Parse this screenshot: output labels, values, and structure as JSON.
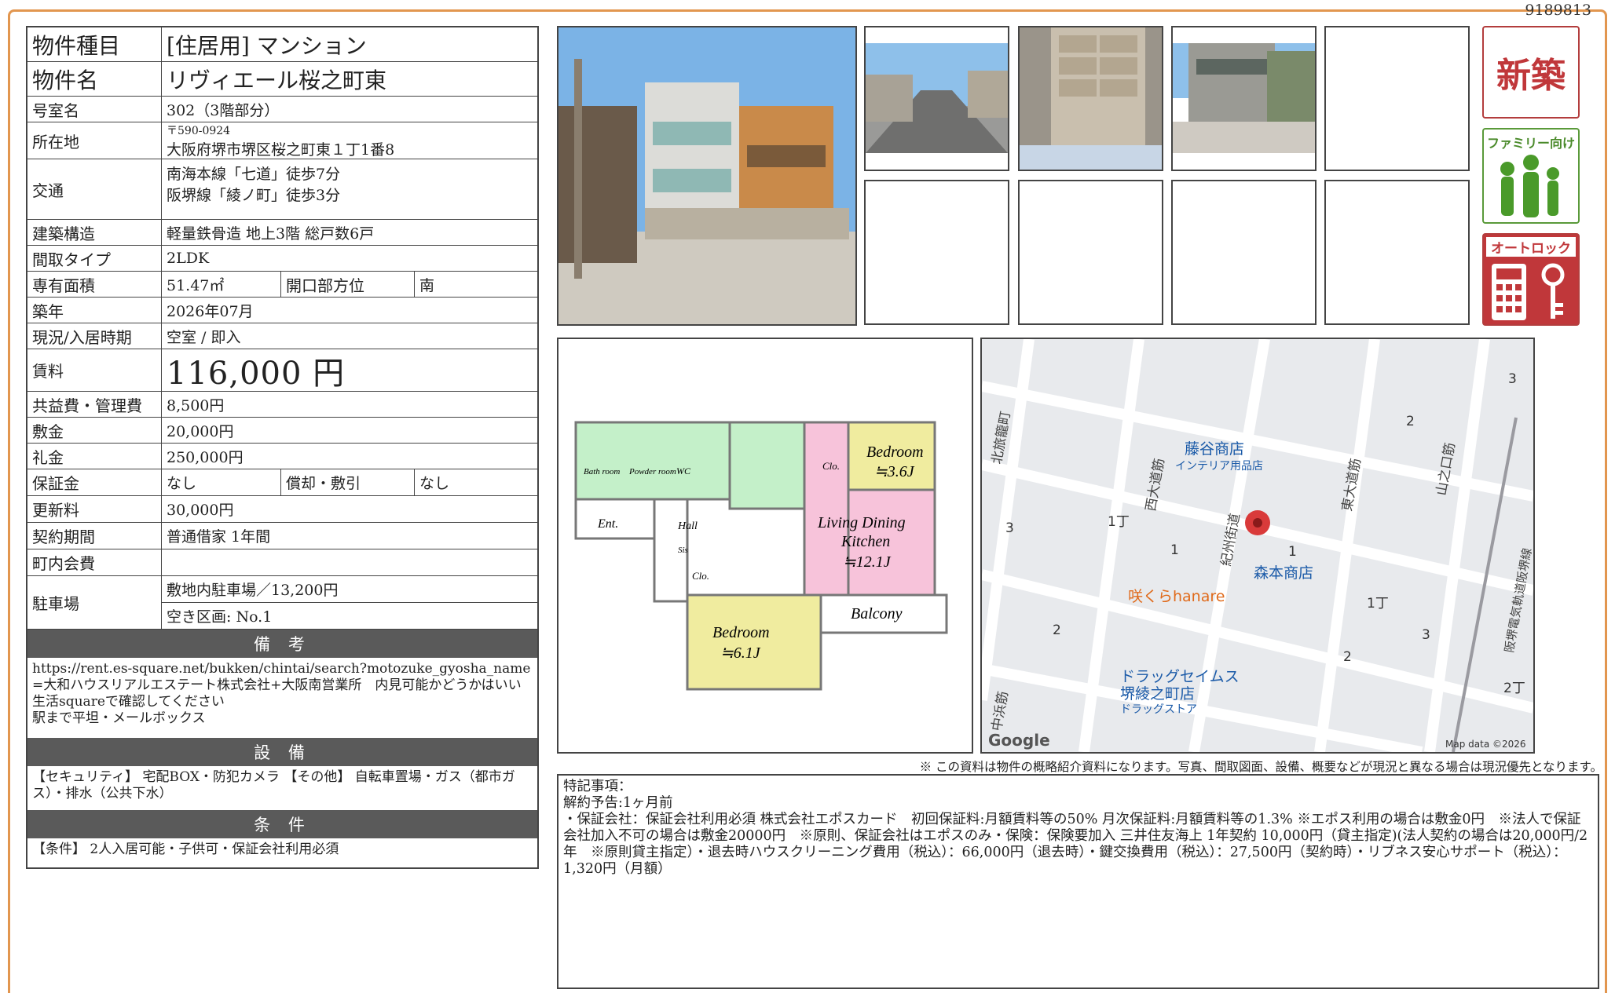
{
  "doc_id": "9189813",
  "table": {
    "type": {
      "label": "物件種目",
      "value": "[住居用]  マンション"
    },
    "name": {
      "label": "物件名",
      "value": "リヴィエール桜之町東"
    },
    "room": {
      "label": "号室名",
      "value": "302（3階部分）"
    },
    "address": {
      "label": "所在地",
      "zip": "〒590-0924",
      "value": "大阪府堺市堺区桜之町東１丁1番8"
    },
    "transport": {
      "label": "交通",
      "line1": "南海本線「七道」徒歩7分",
      "line2": "阪堺線「綾ノ町」徒歩3分"
    },
    "structure": {
      "label": "建築構造",
      "value": "軽量鉄骨造  地上3階  総戸数6戸"
    },
    "layout": {
      "label": "間取タイプ",
      "value": "2LDK"
    },
    "area": {
      "label": "専有面積",
      "value": "51.47㎡",
      "label2": "開口部方位",
      "value2": "南"
    },
    "built": {
      "label": "築年",
      "value": "2026年07月"
    },
    "status": {
      "label": "現況/入居時期",
      "value": "空室 / 即入"
    },
    "rent": {
      "label": "賃料",
      "value": "116,000 円"
    },
    "fee": {
      "label": "共益費・管理費",
      "value": "8,500円"
    },
    "deposit": {
      "label": "敷金",
      "value": "20,000円"
    },
    "key_money": {
      "label": "礼金",
      "value": "250,000円"
    },
    "guarantee": {
      "label": "保証金",
      "value": "なし",
      "label2": "償却・敷引",
      "value2": "なし"
    },
    "renewal": {
      "label": "更新料",
      "value": "30,000円"
    },
    "contract": {
      "label": "契約期間",
      "value": "普通借家 1年間"
    },
    "town_fee": {
      "label": "町内会費",
      "value": ""
    },
    "parking": {
      "label": "駐車場",
      "value1": "敷地内駐車場／13,200円",
      "value2": "空き区画: No.1"
    }
  },
  "remarks": {
    "title": "備 考",
    "text1": "https://rent.es-square.net/bukken/chintai/search?motozuke_gyosha_name=大和ハウスリアルエステート株式会社+大阪南営業所　内見可能かどうかはいい生活squareで確認してください",
    "text2": "駅まで平坦・メールボックス"
  },
  "equipment": {
    "title": "設 備",
    "text": "【セキュリティ】 宅配BOX・防犯カメラ 【その他】 自転車置場・ガス（都市ガス）・排水（公共下水）"
  },
  "conditions": {
    "title": "条 件",
    "text": "【条件】 2人入居可能・子供可・保証会社利用必須"
  },
  "badges": {
    "new": "新築",
    "family": "ファミリー向け",
    "autolock": "オートロック"
  },
  "floorplan": {
    "bedroom1": "Bedroom",
    "bedroom1_size": "≒3.6J",
    "ldk1": "Living Dining",
    "ldk2": "Kitchen",
    "ldk_size": "≒12.1J",
    "bedroom2": "Bedroom",
    "bedroom2_size": "≒6.1J",
    "balcony": "Balcony",
    "bath": "Bath room",
    "powder": "Powder room",
    "wc": "WC",
    "ent": "Ent.",
    "hall": "Hall",
    "clo": "Clo.",
    "sis": "Sis"
  },
  "map": {
    "shop1": "藤谷商店",
    "shop1_sub": "インテリア用品店",
    "shop2": "森本商店",
    "cafe": "咲くらhanare",
    "drug": "ドラッグセイムス",
    "drug2": "堺綾之町店",
    "drug_sub": "ドラッグストア",
    "st1": "北旅籠町",
    "st2": "西大道筋",
    "st3": "紀州街道",
    "st4": "東大道筋",
    "st5": "山之口筋",
    "st6": "阪堺電気軌道阪堺線",
    "st7": "中浜筋",
    "n1": "3",
    "n2": "2",
    "n3": "1丁",
    "n4": "1",
    "n5": "1",
    "n6": "3",
    "n7": "2",
    "n8": "1丁",
    "n9": "3",
    "n10": "2",
    "n11": "2丁",
    "google": "Google",
    "credit": "Map data ©2026"
  },
  "disclaimer": "※ この資料は物件の概略紹介資料になります。写真、間取図面、設備、概要などが現況と異なる場合は現況優先となります。",
  "special": {
    "title": "特記事項：",
    "l1": "解約予告:1ヶ月前",
    "l2": "・保証会社：保証会社利用必須  株式会社エポスカード　初回保証料:月額賃料等の50%  月次保証料:月額賃料等の1.3%  ※エポス利用の場合は敷金0円　※法人で保証会社加入不可の場合は敷金20000円　※原則、保証会社はエポスのみ・保険：保険要加入 三井住友海上 1年契約 10,000円（貸主指定)(法人契約の場合は20,000円/2年　※原則貸主指定）・退去時ハウスクリーニング費用（税込）：66,000円（退去時）・鍵交換費用（税込）：27,500円（契約時）・リブネス安心サポート（税込）：1,320円（月額）"
  }
}
